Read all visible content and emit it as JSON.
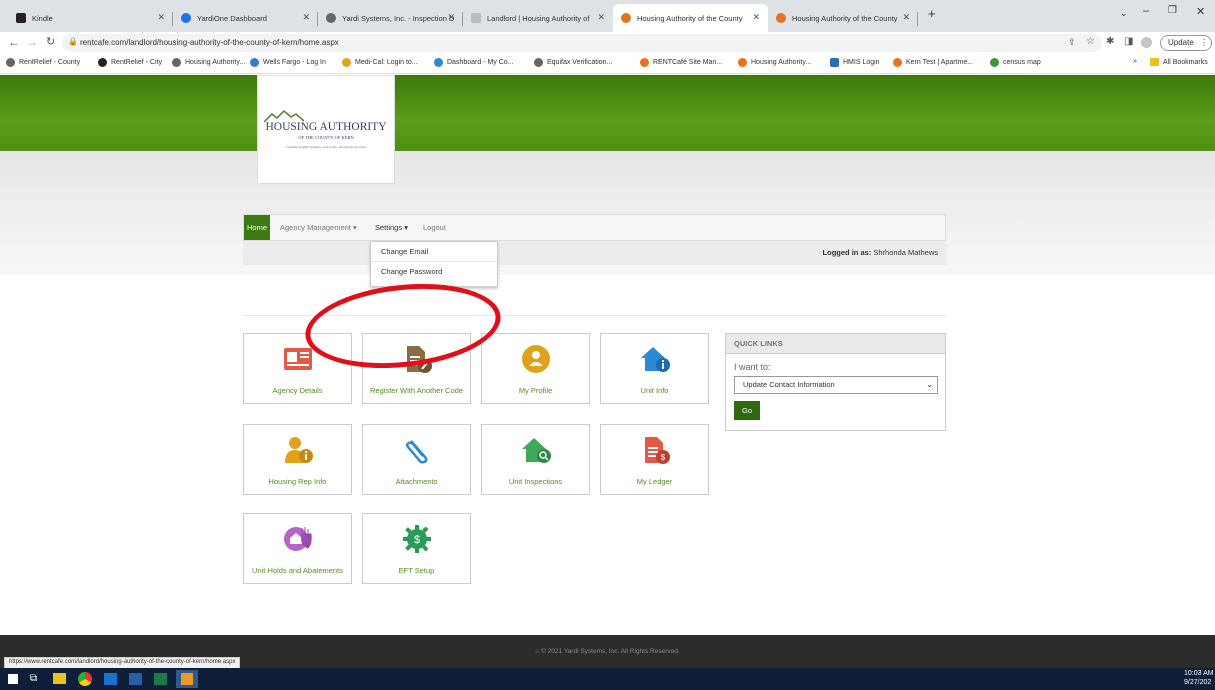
{
  "browser": {
    "tabs": [
      {
        "title": "Kindle",
        "color": "#222222"
      },
      {
        "title": "YardiOne Dashboard",
        "color": "#1a73e8"
      },
      {
        "title": "Yardi Systems, Inc. - Inspection D",
        "color": "#555555"
      },
      {
        "title": "Landlord | Housing Authority of",
        "color": "#888888"
      },
      {
        "title": "Housing Authority of the County",
        "color": "#e8711a"
      },
      {
        "title": "Housing Authority of the County",
        "color": "#e8711a"
      }
    ],
    "new_tab": "+",
    "url": "rentcafe.com/landlord/housing-authority-of-the-county-of-kern/home.aspx",
    "update_label": "Update",
    "bookmarks": [
      "RentRelief - County",
      "RentRelief - City",
      "Housing Authority...",
      "Wells Fargo - Log In",
      "Medi-Cal: Login to...",
      "Dashboard - My Co...",
      "Equifax Verification...",
      "RENTCafé Site Man...",
      "Housing Authority...",
      "HMIS Login",
      "Kern Test | Apartme...",
      "census map"
    ],
    "more_bookmarks": "»",
    "all_bookmarks": "All Bookmarks",
    "status_url": "https://www.rentcafe.com/landlord/housing-authority-of-the-county-of-kern/home.aspx"
  },
  "logo": {
    "line1": "HOUSING AUTHORITY",
    "line2": "OF THE COUNTY OF KERN",
    "tagline": "Creating brighter futures...one home, one family at a time"
  },
  "nav": {
    "home": "Home",
    "agency": "Agency Management",
    "settings": "Settings",
    "logout": "Logout",
    "logged_in_label": "Logged in as:",
    "logged_in_user": "Shrhonda Mathews"
  },
  "dropdown": {
    "items": [
      "Change Email",
      "Change Password"
    ]
  },
  "tiles": [
    {
      "label": "Agency Details",
      "icon": "agency-details-icon",
      "color": "#e05a45"
    },
    {
      "label": "Register With Another Code",
      "icon": "register-document-icon",
      "color": "#8b6b43"
    },
    {
      "label": "My Profile",
      "icon": "profile-icon",
      "color": "#e0a21a"
    },
    {
      "label": "Unit Info",
      "icon": "unit-info-icon",
      "color": "#2a8ad4"
    },
    {
      "label": "Housing Rep Info",
      "icon": "housing-rep-icon",
      "color": "#e0a21a"
    },
    {
      "label": "Attachments",
      "icon": "paperclip-icon",
      "color": "#2a8ad4"
    },
    {
      "label": "Unit Inspections",
      "icon": "unit-inspection-icon",
      "color": "#3fa85a"
    },
    {
      "label": "My Ledger",
      "icon": "ledger-icon",
      "color": "#e05a45"
    },
    {
      "label": "Unit Holds and Abatements",
      "icon": "unit-holds-icon",
      "color": "#b565c9"
    },
    {
      "label": "EFT Setup",
      "icon": "eft-gear-icon",
      "color": "#2a9a5a"
    }
  ],
  "quick_links": {
    "title": "QUICK LINKS",
    "prompt": "I want to:",
    "selected": "Update Contact Information",
    "go": "Go"
  },
  "footer": {
    "copyright": "© 2021 Yardi Systems, Inc. All Rights Reserved."
  },
  "taskbar": {
    "time": "10:03 AM",
    "date": "9/27/202"
  },
  "colors": {
    "brand_green": "#4e8a14",
    "link_green": "#5a8a2a",
    "annotation_red": "#e0101a"
  }
}
